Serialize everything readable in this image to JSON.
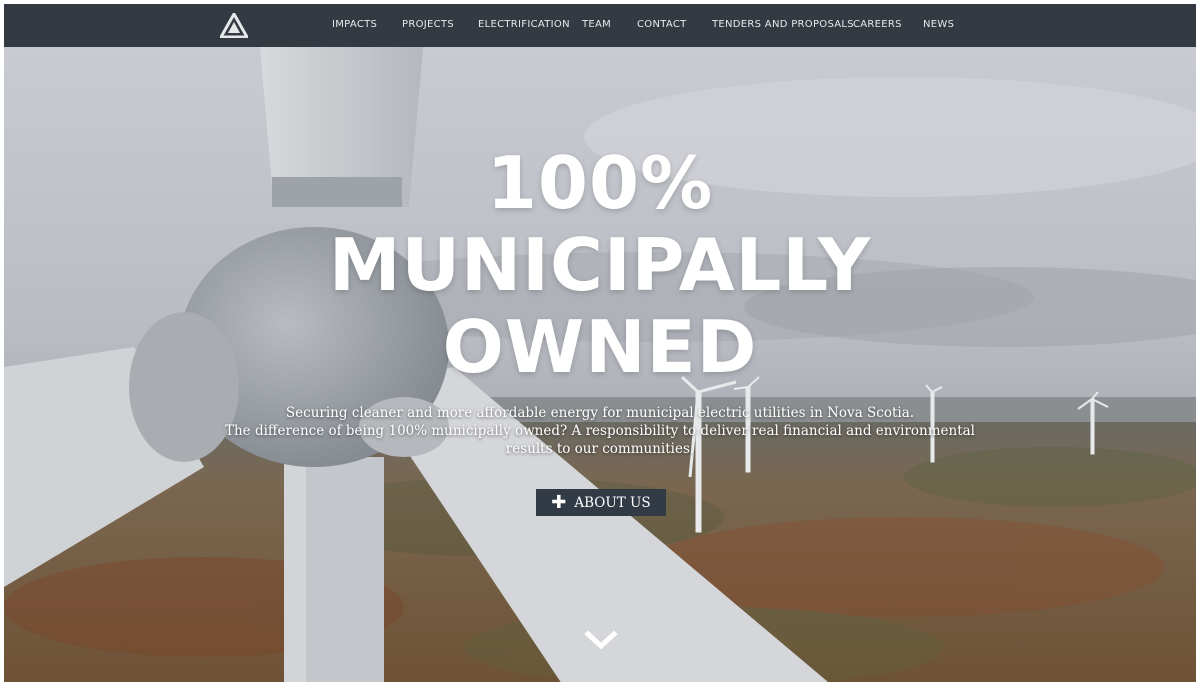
{
  "nav": {
    "logo_icon": "triangle-logo-icon",
    "items": [
      {
        "label": "IMPACTS"
      },
      {
        "label": "PROJECTS"
      },
      {
        "label": "ELECTRIFICATION"
      },
      {
        "label": "TEAM"
      },
      {
        "label": "CONTACT"
      },
      {
        "label": "TENDERS AND PROPOSALS"
      },
      {
        "label": "CAREERS"
      },
      {
        "label": "NEWS"
      }
    ]
  },
  "hero": {
    "headline_line1": "100%",
    "headline_line2": "MUNICIPALLY",
    "headline_line3": "OWNED",
    "subtext_line1": "Securing cleaner and more affordable energy for municipal electric utilities in Nova Scotia.",
    "subtext_line2": "The difference of being 100% municipally owned? A responsibility to deliver real financial and environmental results to our communities.",
    "button_label": "ABOUT US",
    "button_icon": "plus-icon",
    "scroll_icon": "chevron-down-icon"
  },
  "colors": {
    "navbar": "#343a42",
    "button": "#323a45",
    "text": "#ffffff"
  }
}
